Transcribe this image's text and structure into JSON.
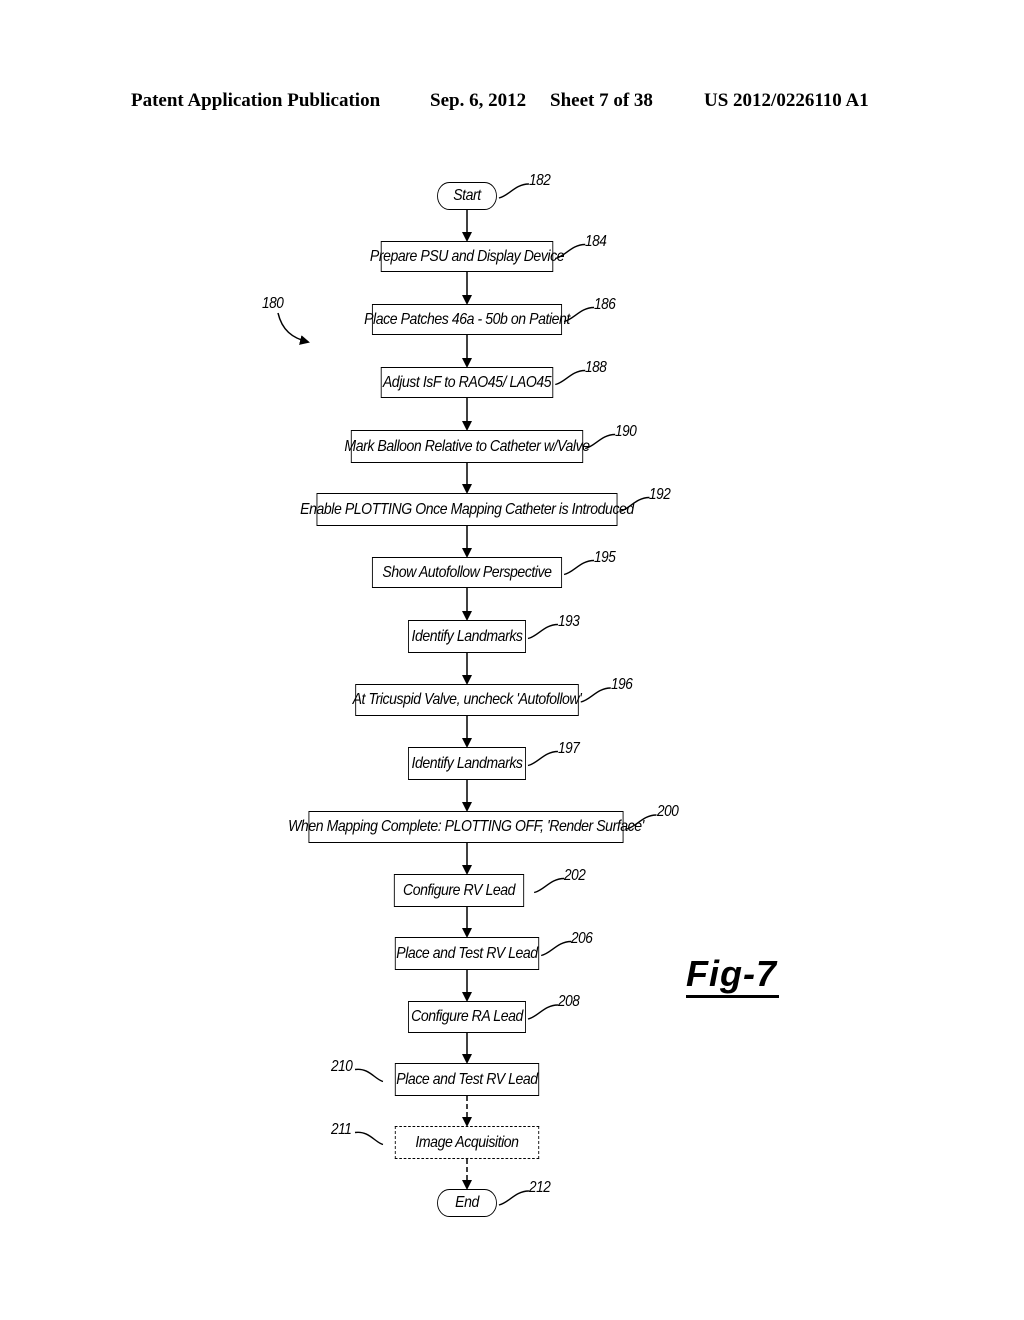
{
  "header": {
    "left": "Patent Application Publication",
    "date": "Sep. 6, 2012",
    "sheet": "Sheet 7 of 38",
    "number": "US 2012/0226110 A1"
  },
  "figure": {
    "label": "Fig-7",
    "ref": "180"
  },
  "flow": {
    "nodes": [
      {
        "id": "182",
        "text": "Start",
        "shape": "terminal"
      },
      {
        "id": "184",
        "text": "Prepare PSU and Display Device",
        "shape": "process"
      },
      {
        "id": "186",
        "text": "Place Patches 46a - 50b on Patient",
        "shape": "process"
      },
      {
        "id": "188",
        "text": "Adjust IsF to RAO45/ LAO45",
        "shape": "process"
      },
      {
        "id": "190",
        "text": "Mark Balloon Relative to Catheter w/Valve",
        "shape": "process"
      },
      {
        "id": "192",
        "text": "Enable PLOTTING Once Mapping Catheter is Introduced",
        "shape": "process"
      },
      {
        "id": "195",
        "text": "Show Autofollow Perspective",
        "shape": "process"
      },
      {
        "id": "193",
        "text": "Identify Landmarks",
        "shape": "process"
      },
      {
        "id": "196",
        "text": "At Tricuspid Valve, uncheck 'Autofollow'",
        "shape": "process"
      },
      {
        "id": "197",
        "text": "Identify Landmarks",
        "shape": "process"
      },
      {
        "id": "200",
        "text": "When Mapping Complete: PLOTTING OFF, 'Render Surface'",
        "shape": "process"
      },
      {
        "id": "202",
        "text": "Configure RV Lead",
        "shape": "process"
      },
      {
        "id": "206",
        "text": "Place and Test RV Lead",
        "shape": "process"
      },
      {
        "id": "208",
        "text": "Configure RA Lead",
        "shape": "process"
      },
      {
        "id": "210",
        "text": "Place and Test RV Lead",
        "shape": "process"
      },
      {
        "id": "211",
        "text": "Image Acquisition",
        "shape": "optional"
      },
      {
        "id": "212",
        "text": "End",
        "shape": "terminal"
      }
    ]
  }
}
